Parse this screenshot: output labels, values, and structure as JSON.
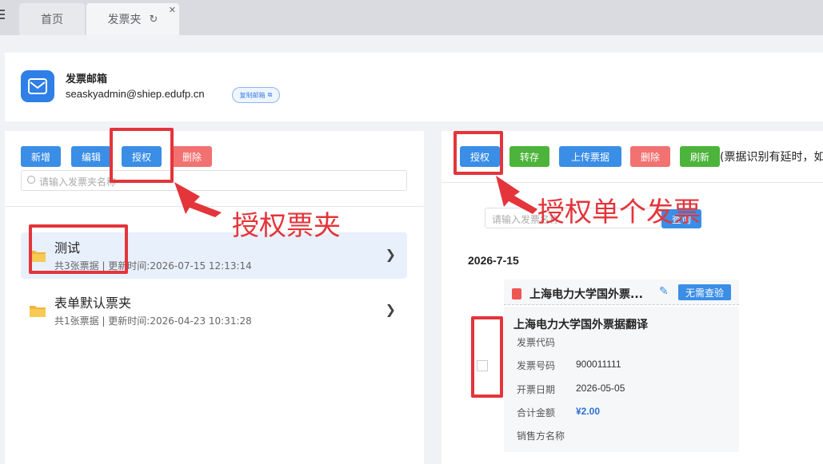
{
  "tabs": [
    {
      "label": "首页"
    },
    {
      "label": "发票夹"
    }
  ],
  "mailbox": {
    "title": "发票邮箱",
    "address": "seaskyadmin@shiep.edufp.cn",
    "copy_label": "复制邮箱"
  },
  "left_toolbar": {
    "add": "新增",
    "edit": "编辑",
    "authorize": "授权",
    "delete": "删除"
  },
  "folder_search": {
    "placeholder": "请输入发票夹名称"
  },
  "folders": [
    {
      "name": "测试",
      "meta": "共3张票据 | 更新时间:2026-07-15 12:13:14"
    },
    {
      "name": "表单默认票夹",
      "meta": "共1张票据 | 更新时间:2026-04-23 10:31:28"
    }
  ],
  "right_toolbar": {
    "authorize": "授权",
    "transfer": "转存",
    "upload": "上传票据",
    "delete": "删除",
    "refresh": "刷新",
    "tip": "(票据识别有延时，如"
  },
  "invoice_search": {
    "placeholder": "请输入发票名称",
    "button": "查询"
  },
  "date_group": "2026-7-15",
  "invoice": {
    "title_short": "上海电力大学国外票...",
    "badge": "无需查验",
    "title": "上海电力大学国外票据翻译",
    "fields": [
      {
        "label": "发票代码",
        "value": ""
      },
      {
        "label": "发票号码",
        "value": "900011111"
      },
      {
        "label": "开票日期",
        "value": "2026-05-05"
      },
      {
        "label": "合计金额",
        "value": "¥2.00"
      },
      {
        "label": "销售方名称",
        "value": ""
      }
    ]
  },
  "annotations": {
    "folder_auth": "授权票夹",
    "single_auth": "授权单个发票"
  },
  "colors": {
    "primary": "#3a8ee6",
    "success": "#4cb43a",
    "danger": "#f27171",
    "annotation": "#e3353b"
  }
}
